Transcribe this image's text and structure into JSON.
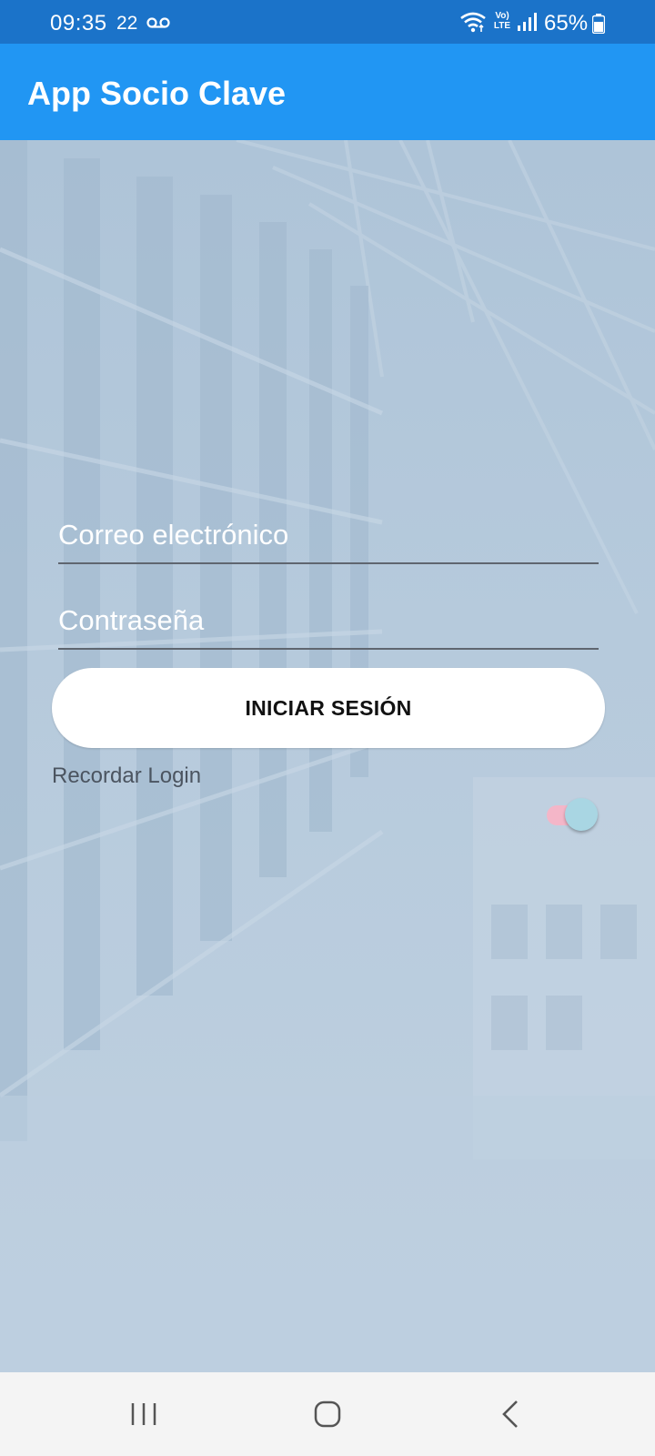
{
  "status_bar": {
    "time": "09:35",
    "notification": "22",
    "battery": "65%",
    "network": "LTE",
    "volte": "Vo)",
    "icons": [
      "voicemail-icon",
      "wifi-icon",
      "volte-icon",
      "signal-icon",
      "battery-icon"
    ]
  },
  "app_bar": {
    "title": "App Socio Clave"
  },
  "login": {
    "email_placeholder": "Correo electrónico",
    "email_value": "",
    "password_placeholder": "Contraseña",
    "password_value": "",
    "button_label": "INICIAR SESIÓN",
    "remember_label": "Recordar Login",
    "remember_enabled": true
  },
  "nav_bar": {
    "buttons": [
      "recent-apps-icon",
      "home-icon",
      "back-icon"
    ]
  },
  "colors": {
    "status_bar": "#1b73c9",
    "app_bar": "#2196f3",
    "background": "#b3c8da",
    "toggle_track": "#f4b6c8",
    "toggle_thumb": "#a9d6e3"
  }
}
